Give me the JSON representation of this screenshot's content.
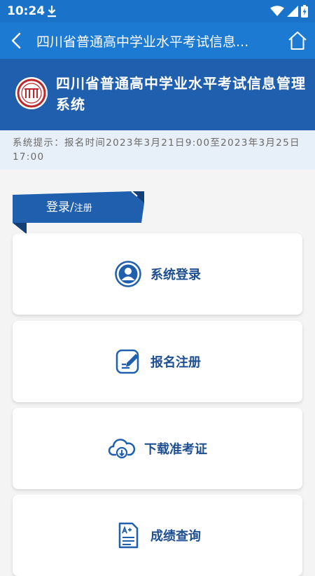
{
  "status_bar": {
    "time": "10:24"
  },
  "app_bar": {
    "title": "四川省普通高中学业水平考试信息..."
  },
  "header": {
    "title": "四川省普通高中学业水平考试信息管理系统"
  },
  "notice": {
    "text": "系统提示：报名时间2023年3月21日9:00至2023年3月25日17:00"
  },
  "section_tab": {
    "main": "登录",
    "sep": "/",
    "sub": "注册"
  },
  "menu": [
    {
      "label": "系统登录",
      "icon": "user-circle-icon"
    },
    {
      "label": "报名注册",
      "icon": "edit-form-icon"
    },
    {
      "label": "下载准考证",
      "icon": "cloud-download-icon"
    },
    {
      "label": "成绩查询",
      "icon": "grade-document-icon"
    }
  ],
  "colors": {
    "status_bar": "#1b73c9",
    "app_bar": "#1d7ad3",
    "header": "#1f5fae",
    "notice_bg": "#e7eff8",
    "accent": "#1e4f91",
    "logo_red": "#c0272d"
  }
}
